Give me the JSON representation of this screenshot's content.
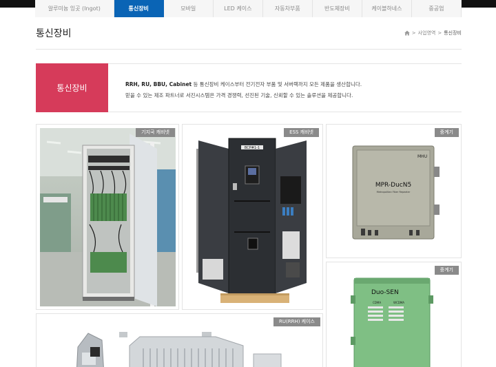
{
  "nav": {
    "tabs": [
      {
        "label": "알루미늄 잉곳 (Ingot)",
        "active": false
      },
      {
        "label": "통신장비",
        "active": true
      },
      {
        "label": "모바일",
        "active": false
      },
      {
        "label": "LED 케이스",
        "active": false
      },
      {
        "label": "자동차부품",
        "active": false
      },
      {
        "label": "반도체장비",
        "active": false
      },
      {
        "label": "케이블하네스",
        "active": false
      },
      {
        "label": "중공업",
        "active": false
      }
    ]
  },
  "page": {
    "title": "통신장비",
    "breadcrumb": {
      "parent": "사업영역",
      "separator": ">",
      "current": "통신장비"
    }
  },
  "intro": {
    "box_label": "통신장비",
    "line1_bold": "RRH, RU, BBU, Cabinet",
    "line1_rest": " 등 통신장비 케이스부터 전기전자 부품 및 서버랙까지 모든 제품을 생산합니다.",
    "line2": "믿을 수 있는 제조 파트너로 서진시스템은 가격 경쟁력, 선진된 기술, 신뢰할 수 있는 솔루션을 제공합니다."
  },
  "products": [
    {
      "label": "기지국 캐비넷"
    },
    {
      "label": "ESS 캐비넷",
      "panel_text": "BCP#1-1"
    },
    {
      "label": "중계기",
      "brand": "MPR-DucN5",
      "sub": "Metropolitan Fiber Repeater",
      "tag": "MHU"
    },
    {
      "label": "중계기",
      "brand": "Duo-SEN",
      "col1": "CDMA",
      "col2": "WCDMA"
    },
    {
      "label": "RU(RRH) 케이스"
    }
  ],
  "colors": {
    "nav_active": "#0a64b5",
    "intro_box": "#d63b5a",
    "label_bg": "#8a8a8a"
  }
}
